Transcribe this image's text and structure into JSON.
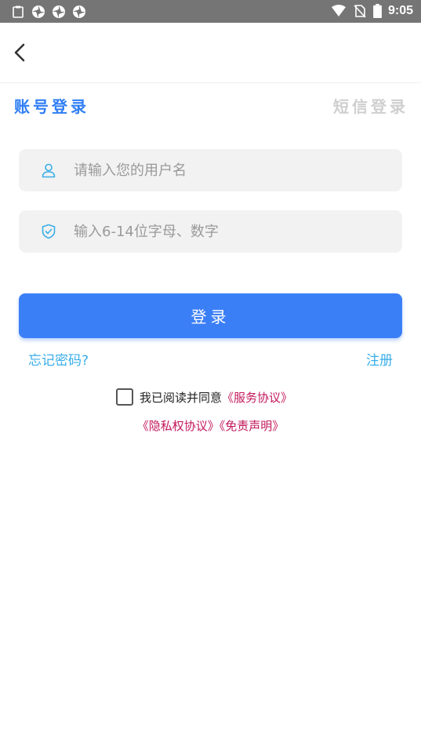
{
  "status_bar": {
    "time": "9:05",
    "left_icons": [
      "clipboard-icon",
      "app-notification-icon",
      "app-notification-icon",
      "app-notification-icon"
    ],
    "right_icons": [
      "wifi-icon",
      "no-sim-icon",
      "battery-icon"
    ]
  },
  "header": {
    "back_icon": "chevron-left-icon"
  },
  "tabs": {
    "account_login": "账号登录",
    "sms_login": "短信登录"
  },
  "form": {
    "username": {
      "value": "",
      "placeholder": "请输入您的用户名",
      "icon": "user-icon"
    },
    "password": {
      "value": "",
      "placeholder": "输入6-14位字母、数字",
      "icon": "shield-icon"
    }
  },
  "login_button": "登录",
  "forgot_password": "忘记密码?",
  "register": "注册",
  "agreement": {
    "prefix": "我已阅读并同意",
    "service": "《服务协议》",
    "privacy": "《隐私权协议》",
    "disclaimer": "《免责声明》",
    "checked": false
  },
  "colors": {
    "primary": "#3b7ff7",
    "tab_active": "#2f7ef5",
    "tab_inactive": "#cfcfcf",
    "link_blue": "#3aaee8",
    "link_red": "#c2185b",
    "input_bg": "#f2f2f2",
    "status_bar": "#757575"
  }
}
